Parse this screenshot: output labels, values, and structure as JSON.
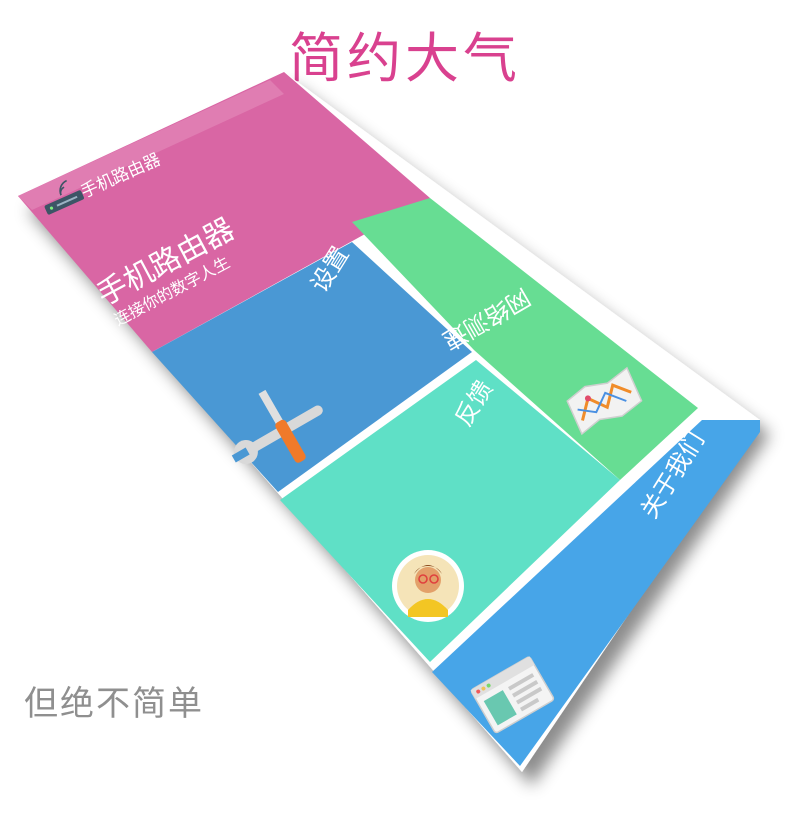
{
  "headline": "简约大气",
  "tagline": "但绝不简单",
  "app": {
    "header_title": "手机路由器",
    "banner_title": "手机路由器",
    "banner_subtitle": "连接你的数字人生"
  },
  "tiles": {
    "settings": "设置",
    "speed_test": "网络测速",
    "feedback": "反馈",
    "about": "关于我们"
  },
  "colors": {
    "banner": "#d966a4",
    "settings": "#4a98d4",
    "speed_test": "#67dd93",
    "feedback": "#5fe0c6",
    "about": "#47a5e8",
    "headline": "#d9418f",
    "tagline": "#8f8f8f"
  },
  "icons": {
    "router": "router-wifi-icon",
    "settings": "wrench-screwdriver-icon",
    "speed_test": "map-route-icon",
    "feedback": "user-avatar-icon",
    "about": "browser-window-icon"
  }
}
